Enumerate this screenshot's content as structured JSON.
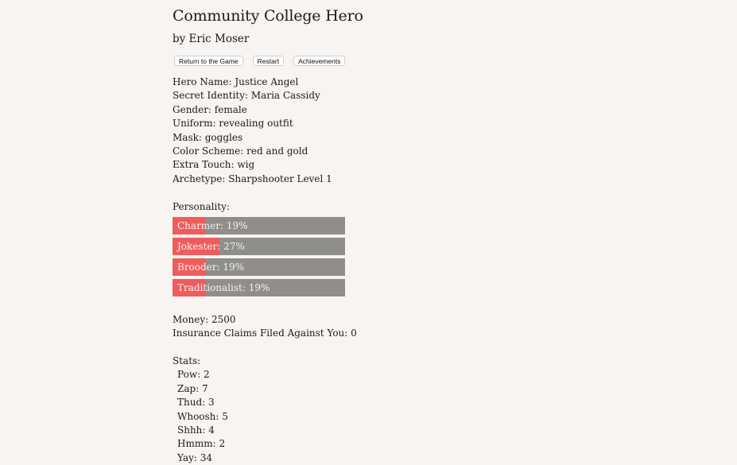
{
  "header": {
    "title": "Community College Hero",
    "author": "by Eric Moser"
  },
  "buttons": {
    "return": "Return to the Game",
    "restart": "Restart",
    "achievements": "Achievements"
  },
  "character": [
    "Hero Name: Justice Angel",
    "Secret Identity: Maria Cassidy",
    "Gender: female",
    "Uniform: revealing outfit",
    "Mask: goggles",
    "Color Scheme: red and gold",
    "Extra Touch: wig",
    "Archetype: Sharpshooter Level 1"
  ],
  "personality": {
    "label": "Personality:",
    "fill_color": "#f05c5c",
    "track_color": "#8f8e8b",
    "traits": [
      {
        "text": "Charmer: 19%",
        "percent": 19
      },
      {
        "text": "Jokester: 27%",
        "percent": 27
      },
      {
        "text": "Brooder: 19%",
        "percent": 19
      },
      {
        "text": "Traditionalist: 19%",
        "percent": 19
      }
    ]
  },
  "finances": [
    "Money: 2500",
    "Insurance Claims Filed Against You: 0"
  ],
  "stats": {
    "label": "Stats:",
    "items": [
      "Pow: 2",
      "Zap: 7",
      "Thud: 3",
      "Whoosh: 5",
      "Shhh: 4",
      "Hmmm: 2",
      "Yay: 34"
    ]
  }
}
